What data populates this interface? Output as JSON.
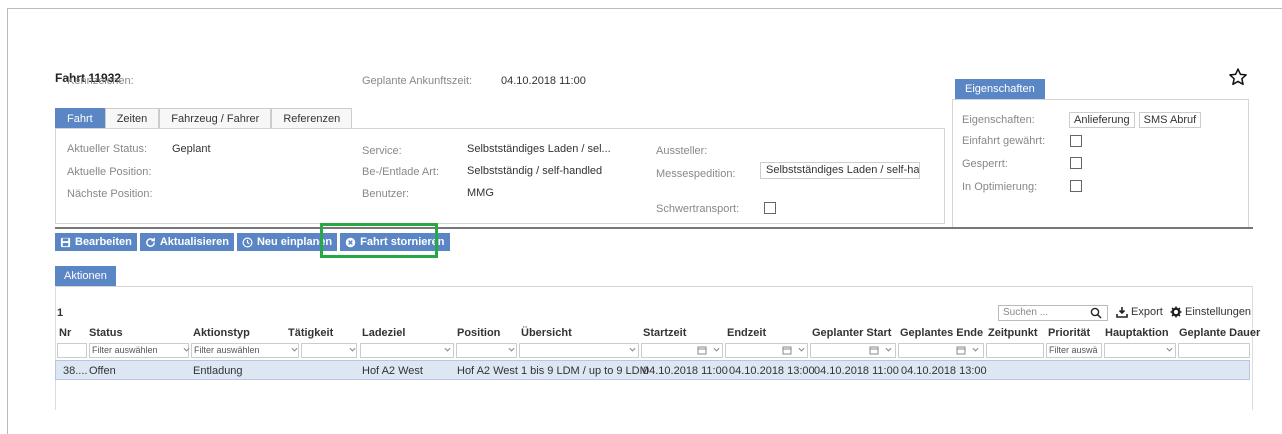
{
  "header": {
    "title": "Fahrt 11932"
  },
  "top_fields": {
    "kennzeichen_label": "Kennzeichen:",
    "ankunft_label": "Geplante Ankunftszeit:",
    "ankunft_value": "04.10.2018 11:00"
  },
  "tabs": [
    {
      "label": "Fahrt"
    },
    {
      "label": "Zeiten"
    },
    {
      "label": "Fahrzeug / Fahrer"
    },
    {
      "label": "Referenzen"
    }
  ],
  "details": {
    "status_label": "Aktueller Status:",
    "status_value": "Geplant",
    "position_label": "Aktuelle Position:",
    "next_label": "Nächste Position:",
    "service_label": "Service:",
    "service_value": "Selbstständiges Laden / sel...",
    "beentlade_label": "Be-/Entlade Art:",
    "beentlade_value": "Selbstständig / self-handled",
    "benutzer_label": "Benutzer:",
    "benutzer_value": "MMG",
    "aussteller_label": "Aussteller:",
    "messe_label": "Messespedition:",
    "messe_value": "Selbstständiges Laden / self-ha...",
    "schwer_label": "Schwertransport:"
  },
  "eigenschaften": {
    "tab_label": "Eigenschaften",
    "props_label": "Eigenschaften:",
    "chips": [
      "Anlieferung",
      "SMS Abruf"
    ],
    "einfahrt_label": "Einfahrt gewährt:",
    "gesperrt_label": "Gesperrt:",
    "optimierung_label": "In Optimierung:"
  },
  "toolbar": {
    "bearbeiten": "Bearbeiten",
    "aktualisieren": "Aktualisieren",
    "neu_einplanen": "Neu einplanen",
    "stornieren": "Fahrt stornieren"
  },
  "aktionen": {
    "tab_label": "Aktionen",
    "count": "1",
    "search_placeholder": "Suchen ...",
    "export": "Export",
    "einstellungen": "Einstellungen",
    "columns": [
      "Nr",
      "Status",
      "Aktionstyp",
      "Tätigkeit",
      "Ladeziel",
      "Position",
      "Übersicht",
      "Startzeit",
      "Endzeit",
      "Geplanter Start",
      "Geplantes Ende",
      "Zeitpunkt",
      "Priorität",
      "Hauptaktion",
      "Geplante Dauer"
    ],
    "filter_placeholder": "Filter auswählen",
    "filter_short": "Filter auswä",
    "row": [
      "38....",
      "Offen",
      "Entladung",
      "",
      "Hof A2 West",
      "Hof A2 West",
      "1 bis 9 LDM / up to 9 LDM",
      "04.10.2018 11:00",
      "04.10.2018 13:00",
      "04.10.2018 11:00",
      "04.10.2018 13:00"
    ]
  },
  "colors": {
    "accent": "#5b86c5",
    "highlight": "#28a745",
    "row_selected": "#dde6f3"
  }
}
